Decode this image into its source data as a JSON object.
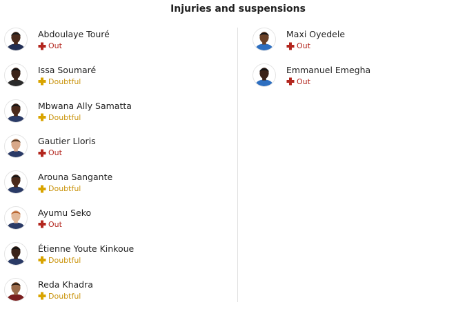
{
  "header": {
    "title": "Injuries and suspensions"
  },
  "colors": {
    "out": "#b3261e",
    "doubtful": "#d9a400"
  },
  "left_players": [
    {
      "name": "Abdoulaye Touré",
      "status": "Out",
      "status_type": "out",
      "skin": "#4a2a1c",
      "hair": "#1a1a1a",
      "shirt": "#222f55"
    },
    {
      "name": "Issa Soumaré",
      "status": "Doubtful",
      "status_type": "doubtful",
      "skin": "#3a2218",
      "hair": "#111111",
      "shirt": "#2b2b2b"
    },
    {
      "name": "Mbwana Ally Samatta",
      "status": "Doubtful",
      "status_type": "doubtful",
      "skin": "#4a2a1c",
      "hair": "#161616",
      "shirt": "#2a3a66"
    },
    {
      "name": "Gautier Lloris",
      "status": "Out",
      "status_type": "out",
      "skin": "#d8a889",
      "hair": "#5a3a22",
      "shirt": "#2a3a66"
    },
    {
      "name": "Arouna Sangante",
      "status": "Doubtful",
      "status_type": "doubtful",
      "skin": "#4a2a1c",
      "hair": "#151515",
      "shirt": "#2a3a66"
    },
    {
      "name": "Ayumu Seko",
      "status": "Out",
      "status_type": "out",
      "skin": "#e2b898",
      "hair": "#b8632e",
      "shirt": "#2a3a66"
    },
    {
      "name": "Étienne Youte Kinkoue",
      "status": "Doubtful",
      "status_type": "doubtful",
      "skin": "#3a2218",
      "hair": "#121212",
      "shirt": "#2a3a66"
    },
    {
      "name": "Reda Khadra",
      "status": "Doubtful",
      "status_type": "doubtful",
      "skin": "#9a6a4a",
      "hair": "#2a1a10",
      "shirt": "#7a1f1f"
    }
  ],
  "right_players": [
    {
      "name": "Maxi Oyedele",
      "status": "Out",
      "status_type": "out",
      "skin": "#6b4228",
      "hair": "#161616",
      "shirt": "#2e6fc0"
    },
    {
      "name": "Emmanuel Emegha",
      "status": "Out",
      "status_type": "out",
      "skin": "#3a2218",
      "hair": "#111111",
      "shirt": "#2e6fc0"
    }
  ]
}
